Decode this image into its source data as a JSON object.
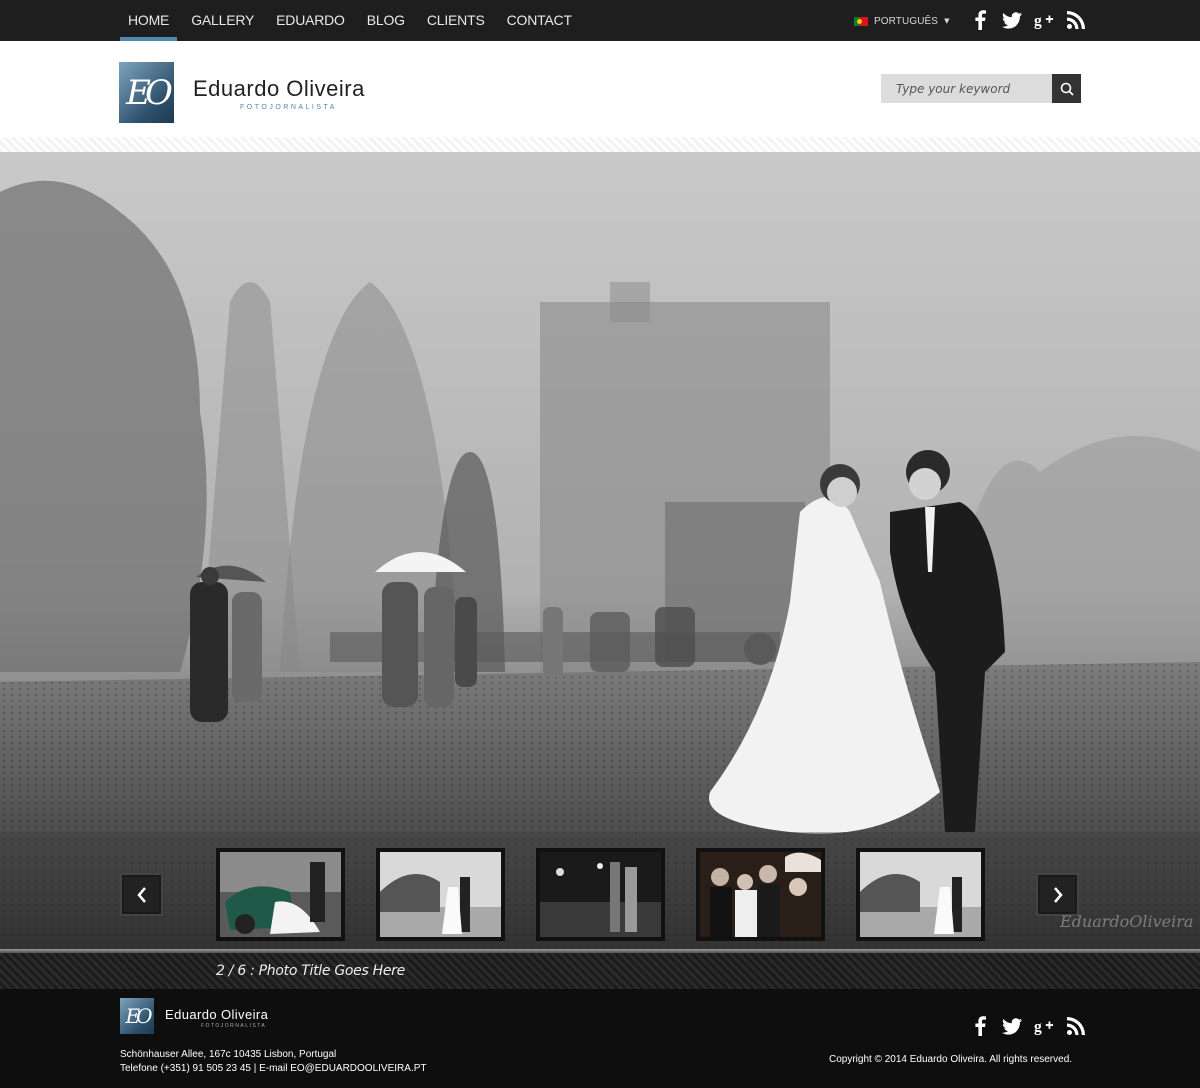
{
  "nav": {
    "items": [
      {
        "label": "HOME",
        "active": true
      },
      {
        "label": "GALLERY",
        "active": false
      },
      {
        "label": "EDUARDO",
        "active": false
      },
      {
        "label": "BLOG",
        "active": false
      },
      {
        "label": "CLIENTS",
        "active": false
      },
      {
        "label": "CONTACT",
        "active": false
      }
    ],
    "accent_color": "#4f89b0"
  },
  "language": {
    "label": "PORTUGUÊS",
    "flag": "portugal-flag"
  },
  "social": [
    "facebook-icon",
    "twitter-icon",
    "google-plus-icon",
    "rss-icon"
  ],
  "brand": {
    "monogram": "EO",
    "name": "Eduardo Oliveira",
    "tagline": "FOTOJORNALISTA"
  },
  "search": {
    "placeholder": "Type your keyword",
    "value": ""
  },
  "gallery": {
    "caption": "2 / 6 : Photo Title Goes Here",
    "thumbnails": [
      {
        "name": "thumb-1"
      },
      {
        "name": "thumb-2"
      },
      {
        "name": "thumb-3"
      },
      {
        "name": "thumb-4"
      },
      {
        "name": "thumb-5"
      }
    ],
    "signature": "EduardoOliveira"
  },
  "footer": {
    "address": "Schönhauser Allee, 167c 10435 Lisbon, Portugal",
    "contact": "Telefone (+351) 91 505 23 45 | E-mail EO@EDUARDOOLIVEIRA.PT",
    "copyright": "Copyright © 2014 Eduardo Oliveira. All rights reserved."
  }
}
